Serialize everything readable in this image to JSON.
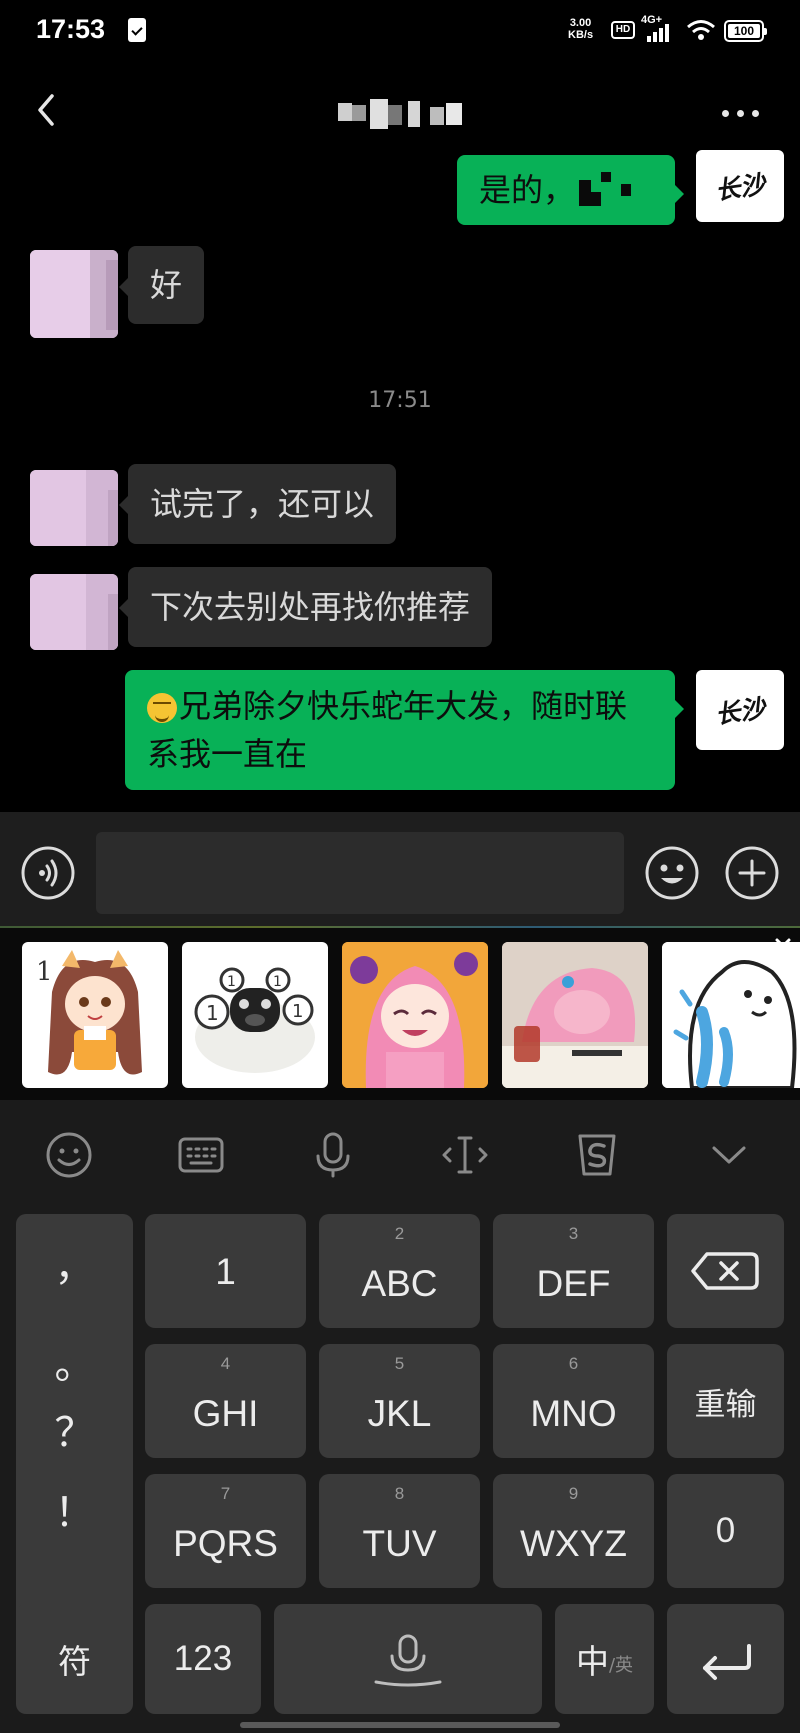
{
  "status_bar": {
    "time": "17:53",
    "net_speed_value": "3.00",
    "net_speed_unit": "KB/s",
    "hd_label": "HD",
    "network_type": "4G+",
    "battery": "100"
  },
  "header": {
    "contact_name_masked": true
  },
  "chat": {
    "messages": [
      {
        "side": "out",
        "text": "是的，"
      },
      {
        "side": "in",
        "text": "好"
      },
      {
        "side": "time",
        "text": "17:51"
      },
      {
        "side": "in",
        "text": "试完了，还可以"
      },
      {
        "side": "in",
        "text": "下次去别处再找你推荐"
      },
      {
        "side": "out",
        "line1": "兄弟除夕快乐蛇年大发，随时联",
        "line2": "系我一直在"
      }
    ],
    "my_avatar_text": "长沙"
  },
  "input_bar": {
    "value": "",
    "placeholder": ""
  },
  "stickers": [
    {
      "icon": "catgirl-sticker",
      "label": "1"
    },
    {
      "icon": "pug-sticker"
    },
    {
      "icon": "pink-hair-girl-sticker"
    },
    {
      "icon": "sleeping-girl-sticker"
    },
    {
      "icon": "cat-crying-sticker"
    }
  ],
  "keyboard": {
    "punctuation": [
      "，",
      "。",
      "？",
      "！"
    ],
    "rows": [
      [
        {
          "num": "",
          "label": "1"
        },
        {
          "num": "2",
          "label": "ABC"
        },
        {
          "num": "3",
          "label": "DEF"
        }
      ],
      [
        {
          "num": "4",
          "label": "GHI"
        },
        {
          "num": "5",
          "label": "JKL"
        },
        {
          "num": "6",
          "label": "MNO"
        }
      ],
      [
        {
          "num": "7",
          "label": "PQRS"
        },
        {
          "num": "8",
          "label": "TUV"
        },
        {
          "num": "9",
          "label": "WXYZ"
        }
      ]
    ],
    "reenter_label": "重输",
    "zero_label": "0",
    "symbol_label": "符",
    "numbers_label": "123",
    "lang_label": "中",
    "lang_sub": "/英"
  },
  "colors": {
    "outgoing_bubble": "#08b157",
    "incoming_bubble": "#2c2c2c",
    "key_bg": "#3a3a3a"
  }
}
